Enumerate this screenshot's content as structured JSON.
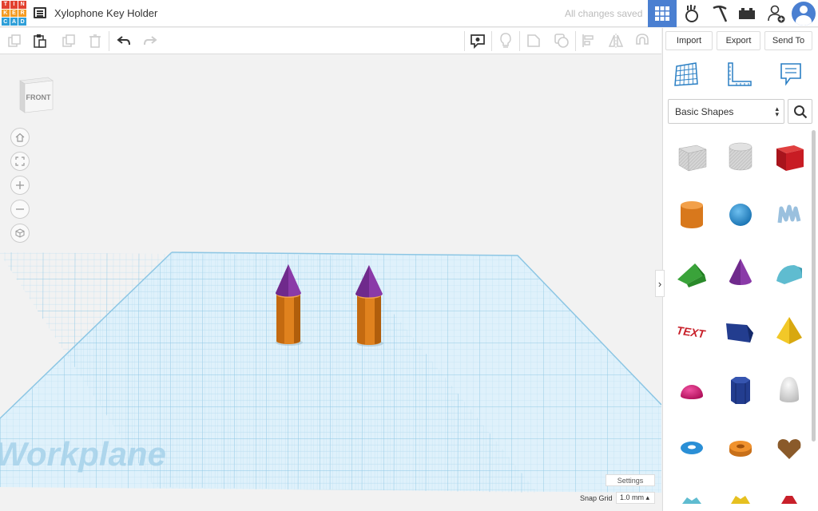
{
  "app": {
    "logo_letters": [
      "T",
      "I",
      "N",
      "K",
      "E",
      "R",
      "C",
      "A",
      "D"
    ],
    "logo_colors": [
      "#e2412f",
      "#e2412f",
      "#e2412f",
      "#f59c24",
      "#f59c24",
      "#f59c24",
      "#2f9fd8",
      "#2f9fd8",
      "#2f9fd8"
    ],
    "title": "Xylophone Key Holder",
    "save_status": "All changes saved",
    "accent": "#4a7fd1"
  },
  "header": {
    "icons": [
      "grid-view-icon",
      "gallery-icon",
      "pickaxe-icon",
      "bricks-icon",
      "add-user-icon",
      "avatar"
    ]
  },
  "toolbar": {
    "tools": [
      "copy-icon",
      "paste-icon",
      "duplicate-icon",
      "delete-icon",
      "undo-icon",
      "redo-icon",
      "notes-icon",
      "light-icon",
      "shape-tool-icon",
      "group-icon",
      "align-icon",
      "mirror-icon",
      "magnet-icon"
    ]
  },
  "panel": {
    "import_label": "Import",
    "export_label": "Export",
    "send_label": "Send To",
    "category": "Basic Shapes"
  },
  "viewport": {
    "viewcube_label": "FRONT",
    "workplane_label": "Workplane",
    "settings_label": "Settings",
    "snap_grid_label": "Snap Grid",
    "snap_grid_value": "1.0 mm ▴"
  },
  "shapes": [
    {
      "name": "box-hole",
      "color": "#b8b8b8"
    },
    {
      "name": "cylinder-hole",
      "color": "#b8b8b8"
    },
    {
      "name": "box",
      "color": "#d0202a"
    },
    {
      "name": "cylinder",
      "color": "#e8882a"
    },
    {
      "name": "sphere",
      "color": "#2a8fd6"
    },
    {
      "name": "scribble",
      "color": "#9ac0de"
    },
    {
      "name": "roof",
      "color": "#3aa33a"
    },
    {
      "name": "cone",
      "color": "#8a3aa8"
    },
    {
      "name": "round-roof",
      "color": "#5fbcd0"
    },
    {
      "name": "text",
      "color": "#d0202a"
    },
    {
      "name": "wedge",
      "color": "#233d8f"
    },
    {
      "name": "pyramid",
      "color": "#f0c020"
    },
    {
      "name": "half-sphere",
      "color": "#e0207a"
    },
    {
      "name": "polygon",
      "color": "#233d8f"
    },
    {
      "name": "paraboloid",
      "color": "#d8d8d8"
    },
    {
      "name": "torus",
      "color": "#2a8fd6"
    },
    {
      "name": "tube",
      "color": "#e8882a"
    },
    {
      "name": "heart",
      "color": "#8a5a2a"
    }
  ]
}
